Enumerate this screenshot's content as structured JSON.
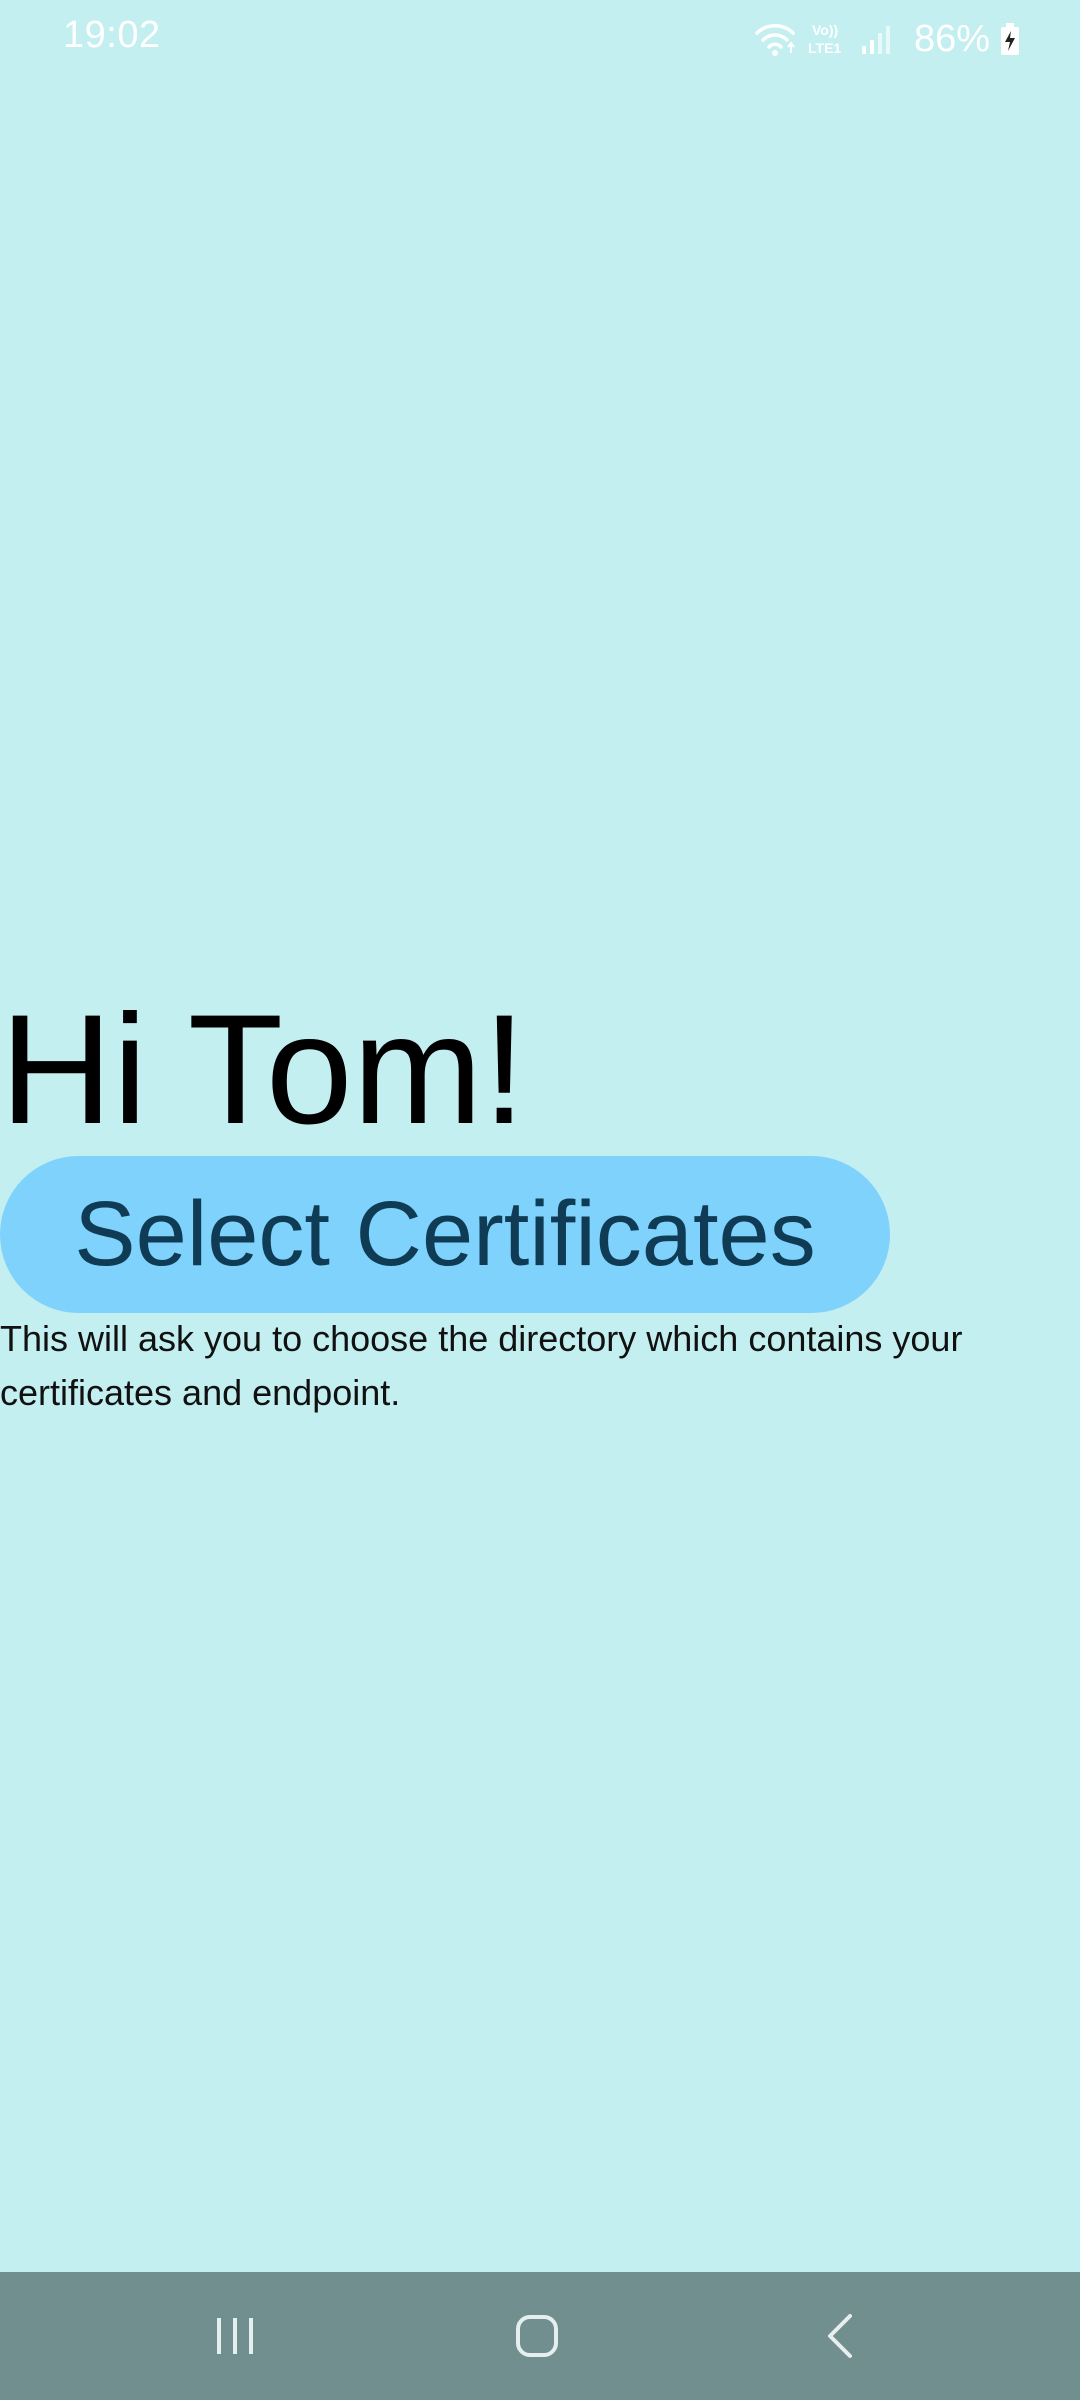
{
  "status_bar": {
    "time": "19:02",
    "battery_percent": "86%",
    "network_label": "Vo)) LTE1",
    "icons": [
      "wifi-icon",
      "volte-icon",
      "signal-icon",
      "battery-charging-icon"
    ]
  },
  "main": {
    "greeting": "Hi Tom!",
    "select_button_label": "Select Certificates",
    "helper_text": "This will ask you to choose the directory which contains your certificates and endpoint."
  },
  "nav_bar": {
    "icons": [
      "recent-apps-icon",
      "home-icon",
      "back-icon"
    ]
  },
  "colors": {
    "background": "#c3eff0",
    "button": "#7ed2fc",
    "button_text": "#0f3b55",
    "nav_bar": "#718f8f"
  }
}
